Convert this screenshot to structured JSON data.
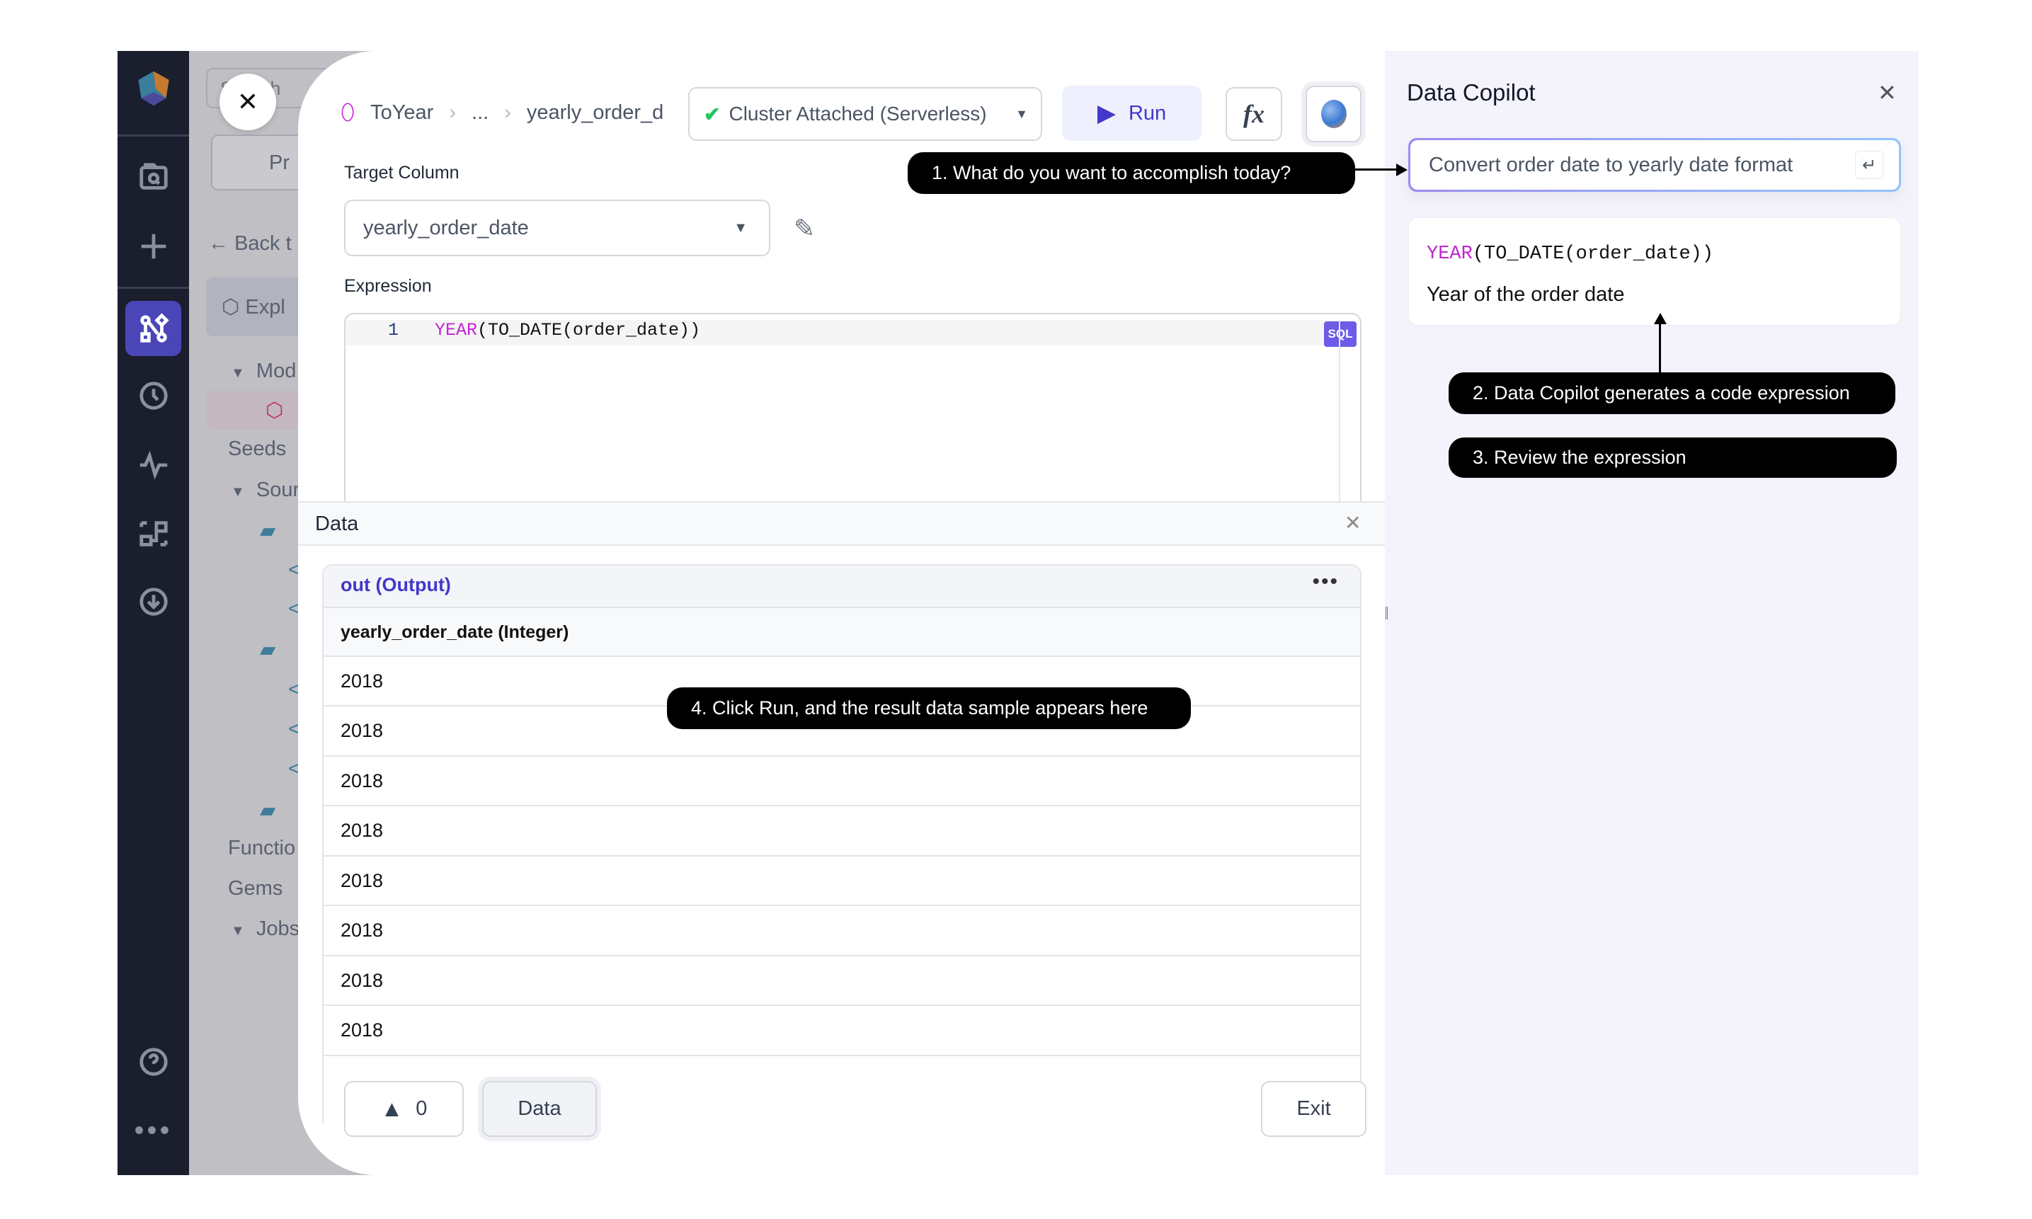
{
  "rail": {
    "icons": [
      "prophecy-logo",
      "search-files-icon",
      "plus-icon",
      "graph-icon",
      "clock-icon",
      "activity-icon",
      "workflow-icon",
      "download-icon",
      "help-icon",
      "more-icon"
    ]
  },
  "back_panel": {
    "search_placeholder": "Search",
    "project_btn": "Pr",
    "back": "Back t",
    "explorer": "Expl",
    "models": "Mod",
    "seeds": "Seeds",
    "sources": "Sour",
    "functions": "Functio",
    "gems": "Gems",
    "jobs": "Jobs"
  },
  "header": {
    "breadcrumb": [
      "ToYear",
      "...",
      "yearly_order_d"
    ],
    "cluster": "Cluster Attached (Serverless)",
    "run": "Run",
    "fx": "fx"
  },
  "form": {
    "target_label": "Target Column",
    "target_value": "yearly_order_date",
    "expression_label": "Expression",
    "line_no": "1",
    "expr_fn": "YEAR",
    "expr_rest": "(TO_DATE(order_date))",
    "lang_badge": "SQL"
  },
  "data_panel": {
    "title": "Data",
    "output_name": "out (Output)",
    "column": "yearly_order_date (Integer)",
    "rows": [
      "2018",
      "2018",
      "2018",
      "2018",
      "2018",
      "2018",
      "2018",
      "2018"
    ]
  },
  "footer": {
    "warnings": "0",
    "data": "Data",
    "exit": "Exit"
  },
  "copilot": {
    "title": "Data Copilot",
    "prompt": "Convert order date to yearly date format",
    "result_fn": "YEAR",
    "result_rest": "(TO_DATE(order_date))",
    "result_desc": "Year of the order date"
  },
  "tips": {
    "t1": "1. What do you want to accomplish today?",
    "t2": "2. Data Copilot generates a code expression",
    "t3": "3. Review the expression",
    "t4": "4. Click Run, and the result data sample appears here"
  },
  "colors": {
    "accent": "#4338ca",
    "rail": "#1a1e2d",
    "keyword": "#c026d3",
    "success": "#22c55e"
  }
}
